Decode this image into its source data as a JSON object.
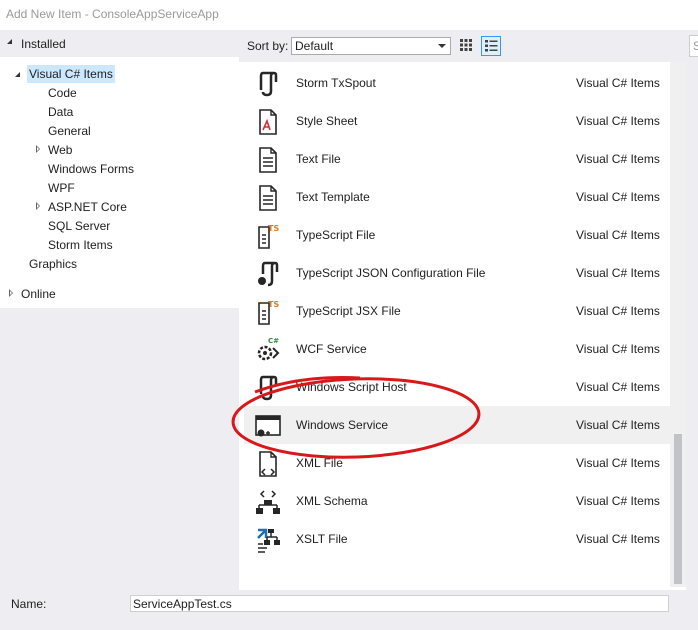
{
  "window": {
    "title": "Add New Item - ConsoleAppServiceApp"
  },
  "left_panel": {
    "installed_label": "Installed",
    "tree": [
      {
        "label": "Visual C# Items",
        "selected": true
      },
      {
        "label": "Code"
      },
      {
        "label": "Data"
      },
      {
        "label": "General"
      },
      {
        "label": "Web"
      },
      {
        "label": "Windows Forms"
      },
      {
        "label": "WPF"
      },
      {
        "label": "ASP.NET Core"
      },
      {
        "label": "SQL Server"
      },
      {
        "label": "Storm Items"
      },
      {
        "label": "Graphics"
      }
    ],
    "online_label": "Online"
  },
  "toolbar": {
    "sort_label": "Sort by:",
    "sort_value": "Default",
    "search_placeholder": "S"
  },
  "templates": [
    {
      "name": "Storm TxSpout",
      "category": "Visual C# Items",
      "icon": "storm-txspout-icon"
    },
    {
      "name": "Style Sheet",
      "category": "Visual C# Items",
      "icon": "style-sheet-icon"
    },
    {
      "name": "Text File",
      "category": "Visual C# Items",
      "icon": "text-file-icon"
    },
    {
      "name": "Text Template",
      "category": "Visual C# Items",
      "icon": "text-template-icon"
    },
    {
      "name": "TypeScript File",
      "category": "Visual C# Items",
      "icon": "typescript-file-icon"
    },
    {
      "name": "TypeScript JSON Configuration File",
      "category": "Visual C# Items",
      "icon": "json-config-icon"
    },
    {
      "name": "TypeScript JSX File",
      "category": "Visual C# Items",
      "icon": "typescript-jsx-icon"
    },
    {
      "name": "WCF Service",
      "category": "Visual C# Items",
      "icon": "wcf-service-icon"
    },
    {
      "name": "Windows Script Host",
      "category": "Visual C# Items",
      "icon": "windows-script-host-icon"
    },
    {
      "name": "Windows Service",
      "category": "Visual C# Items",
      "icon": "windows-service-icon",
      "highlighted": true
    },
    {
      "name": "XML File",
      "category": "Visual C# Items",
      "icon": "xml-file-icon"
    },
    {
      "name": "XML Schema",
      "category": "Visual C# Items",
      "icon": "xml-schema-icon"
    },
    {
      "name": "XSLT File",
      "category": "Visual C# Items",
      "icon": "xslt-file-icon"
    }
  ],
  "footer": {
    "name_label": "Name:",
    "name_value": "ServiceAppTest.cs"
  },
  "colors": {
    "selection": "#cce8ff",
    "annotation": "#d7191c",
    "ts_badge": "#e07a1f",
    "accent": "#1f6fb5"
  }
}
